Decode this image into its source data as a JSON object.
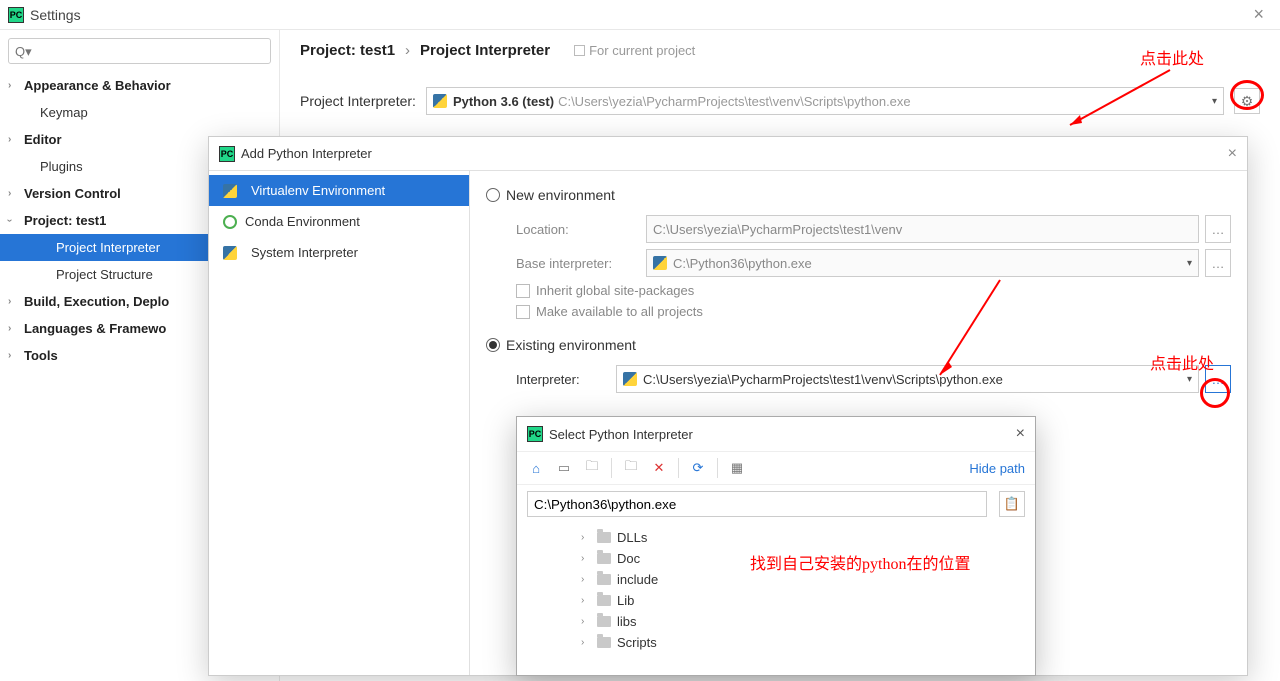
{
  "settings": {
    "title": "Settings",
    "search_placeholder": "Q▾",
    "tree": {
      "appearance": "Appearance & Behavior",
      "keymap": "Keymap",
      "editor": "Editor",
      "plugins": "Plugins",
      "version_control": "Version Control",
      "project": "Project: test1",
      "project_interpreter": "Project Interpreter",
      "project_structure": "Project Structure",
      "build": "Build, Execution, Deplo",
      "languages": "Languages & Framewo",
      "tools": "Tools"
    },
    "breadcrumb": {
      "a": "Project: test1",
      "b": "Project Interpreter",
      "note": "For current project"
    },
    "interp_label": "Project Interpreter:",
    "interp_name": "Python 3.6 (test)",
    "interp_path": "C:\\Users\\yezia\\PycharmProjects\\test\\venv\\Scripts\\python.exe"
  },
  "annotations": {
    "click_here": "点击此处",
    "find_python": "找到自己安装的python在的位置"
  },
  "add_dialog": {
    "title": "Add Python Interpreter",
    "side": {
      "venv": "Virtualenv Environment",
      "conda": "Conda Environment",
      "system": "System Interpreter"
    },
    "new_env": "New environment",
    "existing_env": "Existing environment",
    "location_label": "Location:",
    "location_value": "C:\\Users\\yezia\\PycharmProjects\\test1\\venv",
    "base_label": "Base interpreter:",
    "base_value": "C:\\Python36\\python.exe",
    "inherit": "Inherit global site-packages",
    "make_avail": "Make available to all projects",
    "interp_label": "Interpreter:",
    "interp_value": "C:\\Users\\yezia\\PycharmProjects\\test1\\venv\\Scripts\\python.exe"
  },
  "select_dialog": {
    "title": "Select Python Interpreter",
    "hide_path": "Hide path",
    "path_value": "C:\\Python36\\python.exe",
    "folders": [
      "DLLs",
      "Doc",
      "include",
      "Lib",
      "libs",
      "Scripts"
    ]
  }
}
